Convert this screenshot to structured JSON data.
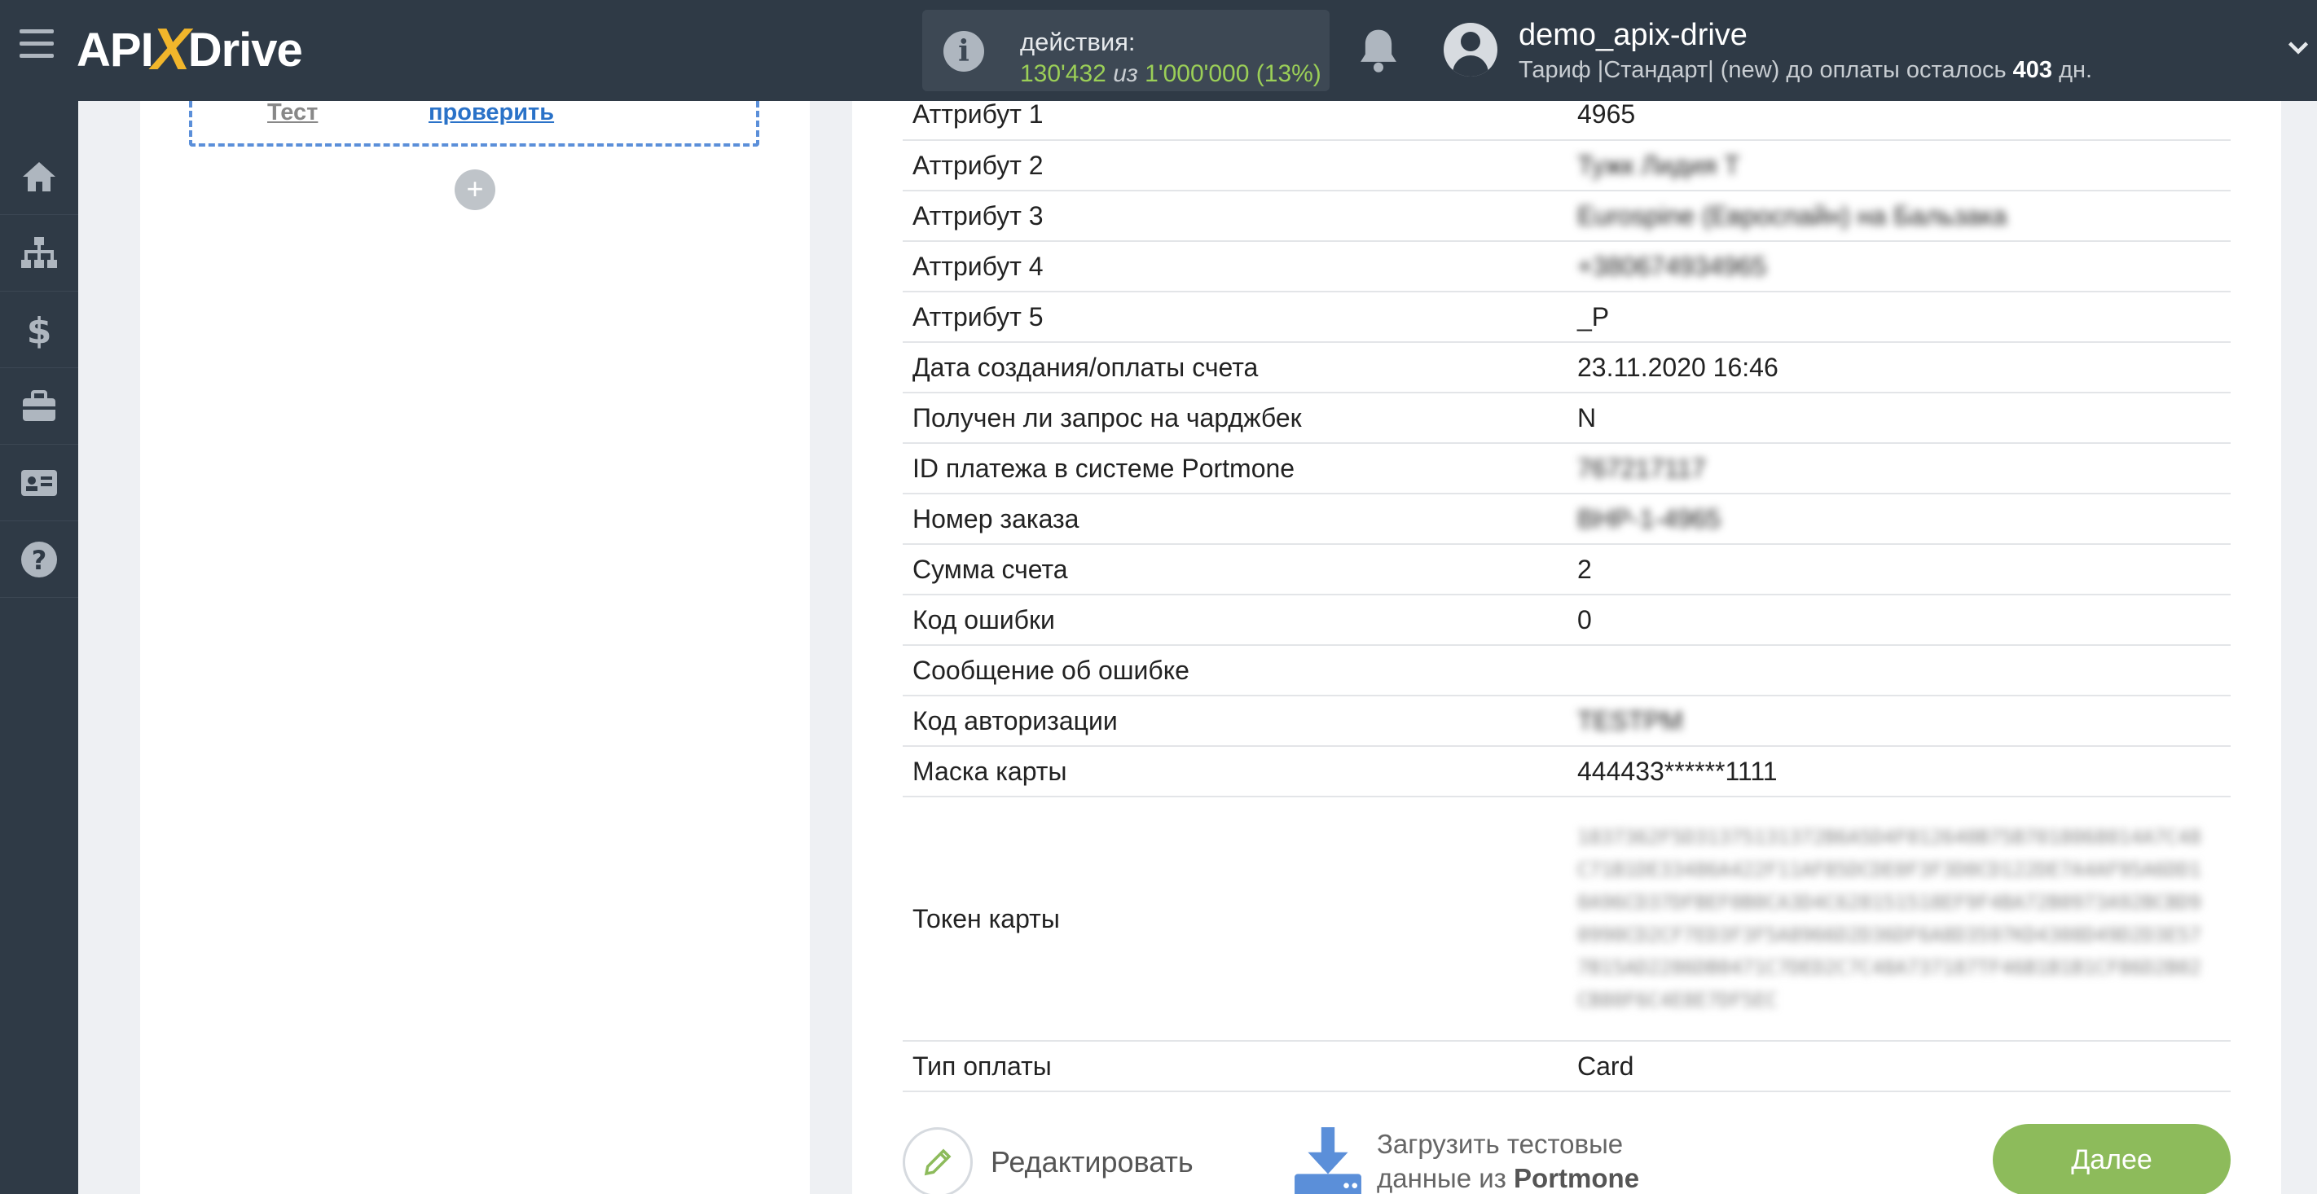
{
  "header": {
    "logo_prefix": "API",
    "logo_x": "X",
    "logo_suffix": "Drive",
    "actions_label": "действия:",
    "actions_used": "130'432",
    "actions_of": "из",
    "actions_total": "1'000'000",
    "actions_extra": "(13%)",
    "user_name": "demo_apix-drive",
    "plan_text": "Тариф |Стандарт| (new) до оплаты осталось",
    "plan_days": "403",
    "plan_days_unit": "дн."
  },
  "sidebar": {
    "items": [
      "home-icon",
      "sitemap-icon",
      "dollar-icon",
      "briefcase-icon",
      "id-card-icon",
      "help-icon"
    ]
  },
  "left_panel": {
    "test_link": "Тест",
    "check_link": "проверить",
    "add_symbol": "+"
  },
  "fields": [
    {
      "label": "Аттрибут 1",
      "value": "4965",
      "blurred": false
    },
    {
      "label": "Аттрибут 2",
      "value": "Тужк Лидия Т",
      "blurred": true
    },
    {
      "label": "Аттрибут 3",
      "value": "Eurospine (Евроспайн) на Бальзака",
      "blurred": true
    },
    {
      "label": "Аттрибут 4",
      "value": "+380674934965",
      "blurred": true
    },
    {
      "label": "Аттрибут 5",
      "value": "_P",
      "blurred": false
    },
    {
      "label": "Дата создания/оплаты счета",
      "value": "23.11.2020 16:46",
      "blurred": false
    },
    {
      "label": "Получен ли запрос на чарджбек",
      "value": "N",
      "blurred": false
    },
    {
      "label": "ID платежа в системе Portmone",
      "value": "767217117",
      "blurred": true
    },
    {
      "label": "Номер заказа",
      "value": "BHP-1-4965",
      "blurred": true
    },
    {
      "label": "Сумма счета",
      "value": "2",
      "blurred": false
    },
    {
      "label": "Код ошибки",
      "value": "0",
      "blurred": false
    },
    {
      "label": "Сообщение об ошибке",
      "value": "",
      "blurred": false
    },
    {
      "label": "Код авторизации",
      "value": "TESTPM",
      "blurred": true
    },
    {
      "label": "Маска карты",
      "value": "444433******1111",
      "blurred": false
    }
  ],
  "token": {
    "label": "Токен карты",
    "value": "1837362F5D31375131372B6A5D4F012640B75B7018068014A7C48C71B1DE33486A422F11AF85DCDE0F3F3D0CD122DE7A4AF95A6DD10A96CD37DFBEF0B0CA3D4C628151518EF9F4BA72B0973A92BCBD90990CD2CF7ED3F3F5A8966D2D36DF6A8D3597KD4308D49D2D3E577B15AD2286DB0471C7DED2C7C48A737187TF46B1B1B1CF86D2B02CB80F6C4E8E7DF5EC"
  },
  "payment_type": {
    "label": "Тип оплаты",
    "value": "Card"
  },
  "actions": {
    "edit_label": "Редактировать",
    "load_line1": "Загрузить тестовые",
    "load_line2_prefix": "данные из",
    "load_line2_source": "Portmone",
    "next_label": "Далее"
  },
  "colors": {
    "topbar": "#2f3a46",
    "accent_green": "#8dbb5b",
    "counter_green": "#9bcf57",
    "link_blue": "#2a72c8",
    "logo_x": "#f2b62b"
  }
}
